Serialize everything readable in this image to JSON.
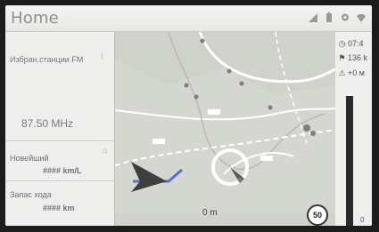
{
  "header": {
    "title": "Home"
  },
  "status_icons": [
    "signal-icon",
    "battery-icon",
    "gear-icon",
    "wifi-icon"
  ],
  "radio": {
    "title": "Избран.станции FM",
    "frequency": "87.50 MHz"
  },
  "economy": {
    "title": "Новейший",
    "value": "#### km/L"
  },
  "range": {
    "title": "Запас хода",
    "value": "#### km"
  },
  "route": {
    "time": "07:4",
    "distance": "136 k",
    "elevation": "+0 м",
    "bar_distance": "0 m"
  },
  "map": {
    "distance_to_turn": "0 m",
    "speed_limit": "50"
  },
  "colors": {
    "header_bg": "#eeeeec",
    "map_bg": "#d6d8d2",
    "road": "#ffffff",
    "route": "#5d6bd0"
  }
}
